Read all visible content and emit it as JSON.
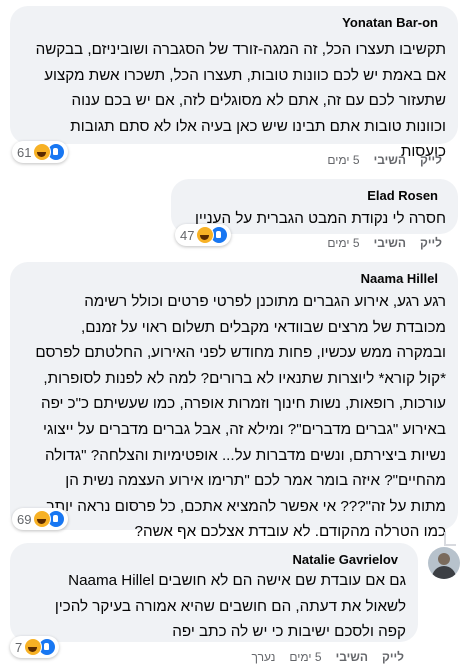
{
  "comments": [
    {
      "author": "Yonatan Bar-on",
      "lines": [
        "תקשיבו תעצרו הכל, זה המגה-זורד של הסגברה ושוביניזם, בבקשה",
        "אם באמת יש לכם כוונות טובות, תעצרו הכל, תשכרו אשת מקצוע",
        "שתעזור לכם עם זה, אתם לא מסוגלים לזה, אם יש בכם ענוה",
        "וכוונות טובות אתם תבינו שיש כאן בעיה אלו לא סתם תגובות",
        "כועסות"
      ],
      "reaction_count": "61",
      "like": "לייק",
      "reply": "השיבי",
      "time": "5 ימים"
    },
    {
      "author": "Elad Rosen",
      "lines": [
        "חסרה לי נקודת המבט הגברית על העניין"
      ],
      "reaction_count": "47",
      "like": "לייק",
      "reply": "השיבי",
      "time": "5 ימים"
    },
    {
      "author": "Naama Hillel",
      "lines": [
        "רגע רגע, אירוע הגברים מתוכנן לפרטי פרטים וכולל רשימה",
        "מכובדת של מרצים שבוודאי מקבלים תשלום ראוי על זמנם,",
        "ובמקרה ממש עכשיו, פחות מחודש לפני האירוע, החלטתם לפרסם",
        "*קול קורא* ליוצרות שתנאיו לא ברורים? למה לא לפנות לסופרות,",
        "עורכות, רופאות, נשות חינוך וזמרות אופרה, כמו שעשיתם כ\"כ יפה",
        "באירוע \"גברים מדברים\"? ומילא זה, אבל גברים מדברים על ייצוגי",
        "נשיות ביצירתם, ונשים מדברות על... אופטימיות והצלחה? \"גדולה",
        "מהחיים\"? איזה בומר אמר לכם \"תרימו אירוע העצמה נשית הן",
        "מתות על זה\"??? אי אפשר להמציא אתכם, כל פרסום נראה יותר",
        "כמו הטרלה מהקודם. לא עובדת אצלכם אף אשה?"
      ],
      "reaction_count": "69",
      "like": "לייק",
      "reply": "השיבי",
      "time": "5 ימים"
    },
    {
      "author": "Natalie Gavrielov",
      "lines": [
        "גם אם עובדת שם אישה הם לא חושבים Naama Hillel",
        "לשאול את דעתה, הם חושבים שהיא אמורה בעיקר להכין",
        "קפה ולסכם ישיבות כי יש לה כתב יפה"
      ],
      "reaction_count": "7",
      "like": "לייק",
      "reply": "השיבי",
      "time": "5 ימים",
      "edited": "נערך"
    }
  ],
  "colors": {
    "bubble": "#f0f2f5",
    "meta": "#65676b",
    "like_blue": "#1877f2",
    "laugh_yellow": "#f7b125"
  },
  "icons": [
    "laugh-reaction-icon",
    "like-reaction-icon",
    "avatar"
  ]
}
